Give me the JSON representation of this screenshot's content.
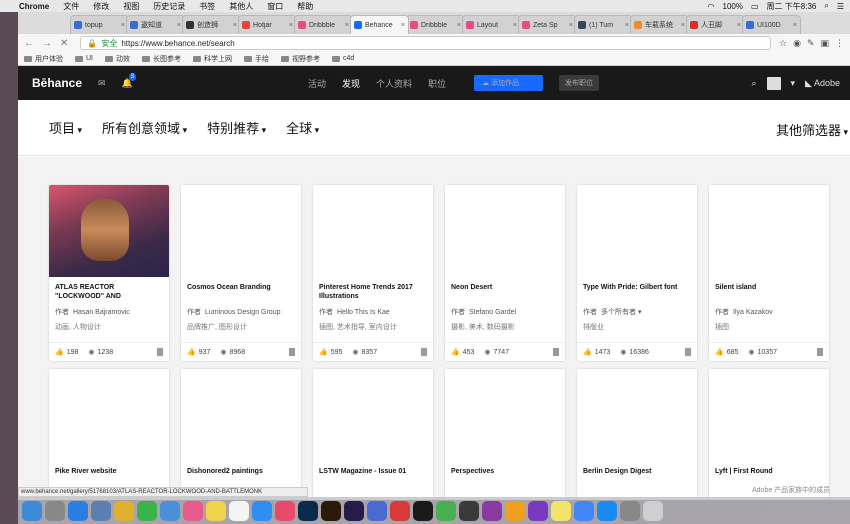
{
  "menubar": {
    "app": "Chrome",
    "items": [
      "文件",
      "修改",
      "视图",
      "历史记录",
      "书签",
      "其他人",
      "窗口",
      "帮助"
    ],
    "battery": "100%",
    "clock": "周二 下午8:36"
  },
  "browser": {
    "tabs": [
      {
        "label": "topup",
        "color": "#3b6ad8"
      },
      {
        "label": "遨知道",
        "color": "#3b6ad8"
      },
      {
        "label": "创造狮",
        "color": "#333"
      },
      {
        "label": "Hotjar",
        "color": "#e8453c"
      },
      {
        "label": "Dribbble",
        "color": "#ea4c89"
      },
      {
        "label": "Behance",
        "color": "#1769ff",
        "active": true
      },
      {
        "label": "Dribbble",
        "color": "#ea4c89"
      },
      {
        "label": "Layout",
        "color": "#ea4c89"
      },
      {
        "label": "Zeta Sp",
        "color": "#ea4c89"
      },
      {
        "label": "(1) Tum",
        "color": "#35465c"
      },
      {
        "label": "车载系统",
        "color": "#f28c28"
      },
      {
        "label": "人丑脚",
        "color": "#d93025"
      },
      {
        "label": "UI100D",
        "color": "#3b6ad8"
      }
    ],
    "security": "安全",
    "url": "https://www.behance.net/search",
    "bookmarks": [
      "用户体验",
      "UI",
      "动效",
      "长图参考",
      "科学上网",
      "手绘",
      "视野参考",
      "c4d"
    ],
    "status_url": "www.behance.net/gallery/51768103/ATLAS-REACTOR-LOCKWOOD-AND-BATTLEMONK"
  },
  "behance": {
    "logo": "Bēhance",
    "notif_count": "3",
    "nav": [
      "活动",
      "发现",
      "个人资料",
      "职位"
    ],
    "active_nav": "发现",
    "add_button": "添加作品",
    "job_button": "发布职位",
    "adobe": "Adobe",
    "filters": [
      "项目",
      "所有创意领域",
      "特别推荐",
      "全球"
    ],
    "more_filters": "其他筛选器",
    "footer_note": "Adobe 产品家族中的成员"
  },
  "projects": [
    {
      "title": "ATLAS REACTOR \"LOCKWOOD\" AND",
      "owner_prefix": "作者",
      "owner": "Hasan Bajramovic",
      "categories": "动画, 人物设计",
      "likes": "198",
      "views": "1238"
    },
    {
      "title": "Cosmos Ocean Branding",
      "owner_prefix": "作者",
      "owner": "Luminous Design Group",
      "categories": "品牌推广, 图形设计",
      "likes": "937",
      "views": "8968"
    },
    {
      "title": "Pinterest Home Trends 2017 Illustrations",
      "owner_prefix": "作者",
      "owner": "Hello This Is Kae",
      "categories": "插图, 艺术指导, 室内设计",
      "likes": "595",
      "views": "8357"
    },
    {
      "title": "Neon Desert",
      "owner_prefix": "作者",
      "owner": "Stefano Gardel",
      "categories": "摄影, 美术, 数码摄影",
      "likes": "453",
      "views": "7747"
    },
    {
      "title": "Type With Pride: Gilbert font",
      "owner_prefix": "作者",
      "owner": "多个所有者 ▾",
      "categories": "排版业",
      "likes": "1473",
      "views": "16386"
    },
    {
      "title": "Silent island",
      "owner_prefix": "作者",
      "owner": "Ilya Kazakov",
      "categories": "插图",
      "likes": "685",
      "views": "10357"
    },
    {
      "title": "Pike River website"
    },
    {
      "title": "Dishonored2 paintings"
    },
    {
      "title": "LSTW Magazine - Issue 01"
    },
    {
      "title": "Perspectives"
    },
    {
      "title": "Berlin Design Digest"
    },
    {
      "title": "Lyft | First Round"
    }
  ],
  "dock": [
    "finder",
    "launchpad",
    "app-store",
    "preview",
    "chrome",
    "wechat",
    "mail",
    "photos",
    "notes",
    "calendar",
    "safari",
    "music",
    "photoshop",
    "illustrator",
    "after-effects",
    "keynote",
    "netease",
    "qq",
    "evernote",
    "sketch",
    "rp",
    "sketch-gem",
    "picsart",
    "notes2",
    "chrome2",
    "browser",
    "calculator",
    "trash"
  ]
}
